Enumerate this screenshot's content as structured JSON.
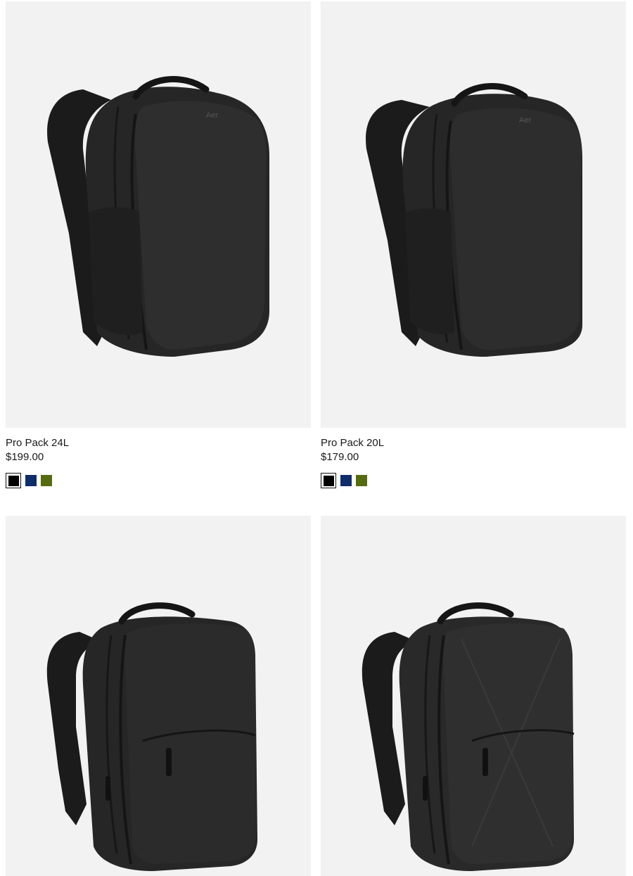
{
  "products": [
    {
      "name": "Pro Pack 24L",
      "price": "$199.00",
      "image_alt": "Pro Pack 24L black backpack",
      "swatches": [
        {
          "color": "#000000",
          "selected": true
        },
        {
          "color": "#0f2c6b",
          "selected": false
        },
        {
          "color": "#556b0f",
          "selected": false
        }
      ]
    },
    {
      "name": "Pro Pack 20L",
      "price": "$179.00",
      "image_alt": "Pro Pack 20L black backpack",
      "swatches": [
        {
          "color": "#000000",
          "selected": true
        },
        {
          "color": "#0f2c6b",
          "selected": false
        },
        {
          "color": "#556b0f",
          "selected": false
        }
      ]
    },
    {
      "image_alt": "Black zippered backpack with front pocket"
    },
    {
      "image_alt": "Black X-Pac backpack with front pocket"
    }
  ],
  "colors": {
    "image_bg": "#f2f2f2",
    "bag": "#262626",
    "text": "#1a1a1a"
  }
}
